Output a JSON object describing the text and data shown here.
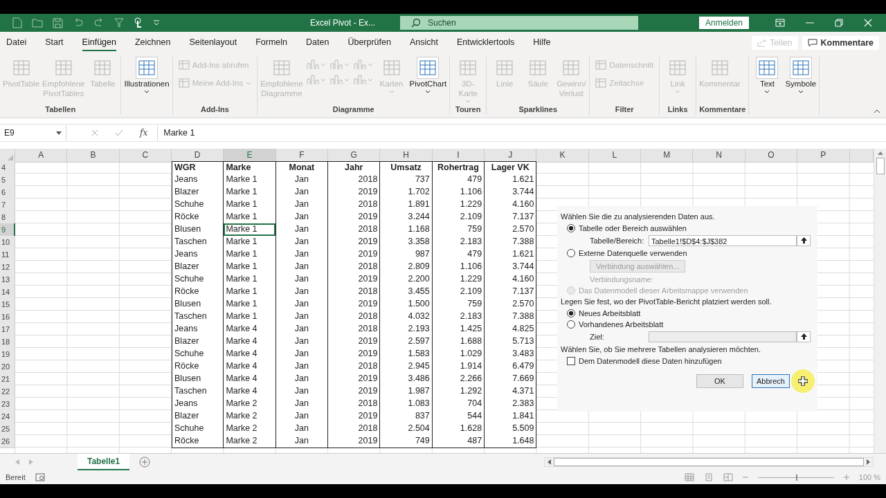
{
  "title_bar": {
    "title": "Excel Pivot  -  Ex...",
    "search_placeholder": "Suchen",
    "sign_in": "Anmelden"
  },
  "menu_tabs": [
    {
      "label": "Datei",
      "selected": false
    },
    {
      "label": "Start",
      "selected": false
    },
    {
      "label": "Einfügen",
      "selected": true
    },
    {
      "label": "Zeichnen",
      "selected": false
    },
    {
      "label": "Seitenlayout",
      "selected": false
    },
    {
      "label": "Formeln",
      "selected": false
    },
    {
      "label": "Daten",
      "selected": false
    },
    {
      "label": "Überprüfen",
      "selected": false
    },
    {
      "label": "Ansicht",
      "selected": false
    },
    {
      "label": "Entwicklertools",
      "selected": false
    },
    {
      "label": "Hilfe",
      "selected": false
    }
  ],
  "share_button": {
    "label": "Teilen",
    "disabled": true
  },
  "comments_button": {
    "label": "Kommentare"
  },
  "ribbon": [
    {
      "label": "Tabellen",
      "items": [
        {
          "kind": "large",
          "label": "PivotTable",
          "disabled": true
        },
        {
          "kind": "large",
          "label": "Empfohlene PivotTables",
          "disabled": true
        },
        {
          "kind": "large",
          "label": "Tabelle",
          "disabled": true
        }
      ]
    },
    {
      "items": [
        {
          "kind": "large",
          "label": "Illustrationen",
          "disabled": false,
          "dropdown": true
        }
      ]
    },
    {
      "label": "Add-Ins",
      "items": [
        {
          "kind": "small",
          "label": "Add-Ins abrufen",
          "disabled": true
        },
        {
          "kind": "small",
          "label": "Meine Add-Ins",
          "disabled": true,
          "dropdown": true
        }
      ]
    },
    {
      "label": "Diagramme",
      "items": [
        {
          "kind": "large",
          "label": "Empfohlene Diagramme",
          "disabled": true
        },
        {
          "kind": "gallery",
          "disabled": true
        },
        {
          "kind": "large",
          "label": "Karten",
          "disabled": true,
          "dropdown": true
        },
        {
          "kind": "large",
          "label": "PivotChart",
          "disabled": false,
          "dropdown": true
        }
      ]
    },
    {
      "label": "Touren",
      "items": [
        {
          "kind": "large",
          "label": "3D-Karte",
          "disabled": true,
          "dropdown": true
        }
      ]
    },
    {
      "label": "Sparklines",
      "items": [
        {
          "kind": "large",
          "label": "Linie",
          "disabled": true
        },
        {
          "kind": "large",
          "label": "Säule",
          "disabled": true
        },
        {
          "kind": "large",
          "label": "Gewinn/ Verlust",
          "disabled": true
        }
      ]
    },
    {
      "label": "Filter",
      "items": [
        {
          "kind": "small",
          "label": "Datenschnitt",
          "disabled": true
        },
        {
          "kind": "small",
          "label": "Zeitachse",
          "disabled": true
        }
      ]
    },
    {
      "label": "Links",
      "items": [
        {
          "kind": "large",
          "label": "Link",
          "disabled": true,
          "dropdown": true
        }
      ]
    },
    {
      "label": "Kommentare",
      "items": [
        {
          "kind": "large",
          "label": "Kommentar",
          "disabled": true
        }
      ]
    },
    {
      "items": [
        {
          "kind": "large",
          "label": "Text",
          "disabled": false,
          "dropdown": true
        },
        {
          "kind": "large",
          "label": "Symbole",
          "disabled": false,
          "dropdown": true
        }
      ]
    }
  ],
  "formula_bar": {
    "name_box": "E9",
    "function_label": "fx",
    "formula": "Marke 1"
  },
  "sheet": {
    "columns": [
      {
        "label": "A",
        "selected": false
      },
      {
        "label": "B",
        "selected": false
      },
      {
        "label": "C",
        "selected": false
      },
      {
        "label": "D",
        "selected": false
      },
      {
        "label": "E",
        "selected": true
      },
      {
        "label": "F",
        "selected": false
      },
      {
        "label": "G",
        "selected": false
      },
      {
        "label": "H",
        "selected": false
      },
      {
        "label": "I",
        "selected": false
      },
      {
        "label": "J",
        "selected": false
      },
      {
        "label": "K",
        "selected": false
      },
      {
        "label": "L",
        "selected": false
      },
      {
        "label": "M",
        "selected": false
      },
      {
        "label": "N",
        "selected": false
      },
      {
        "label": "O",
        "selected": false
      },
      {
        "label": "P",
        "selected": false
      }
    ],
    "rows": [
      {
        "number": "4",
        "kind": "header",
        "selected": false,
        "cells": [
          "",
          "",
          "",
          "WGR",
          "Marke",
          "Monat",
          "Jahr",
          "Umsatz",
          "Rohertrag",
          "Lager VK"
        ]
      },
      {
        "number": "5",
        "kind": "data",
        "selected": false,
        "cells": [
          "",
          "",
          "",
          "Jeans",
          "Marke 1",
          "Jan",
          "2018",
          "737",
          "479",
          "1.621"
        ]
      },
      {
        "number": "6",
        "kind": "data",
        "selected": false,
        "cells": [
          "",
          "",
          "",
          "Blazer",
          "Marke 1",
          "Jan",
          "2019",
          "1.702",
          "1.106",
          "3.744"
        ]
      },
      {
        "number": "7",
        "kind": "data",
        "selected": false,
        "cells": [
          "",
          "",
          "",
          "Schuhe",
          "Marke 1",
          "Jan",
          "2018",
          "1.891",
          "1.229",
          "4.160"
        ]
      },
      {
        "number": "8",
        "kind": "data",
        "selected": false,
        "cells": [
          "",
          "",
          "",
          "Röcke",
          "Marke 1",
          "Jan",
          "2019",
          "3.244",
          "2.109",
          "7.137"
        ]
      },
      {
        "number": "9",
        "kind": "data",
        "selected": true,
        "cells": [
          "",
          "",
          "",
          "Blusen",
          "Marke 1",
          "Jan",
          "2018",
          "1.168",
          "759",
          "2.570"
        ]
      },
      {
        "number": "10",
        "kind": "data",
        "selected": false,
        "cells": [
          "",
          "",
          "",
          "Taschen",
          "Marke 1",
          "Jan",
          "2019",
          "3.358",
          "2.183",
          "7.388"
        ]
      },
      {
        "number": "11",
        "kind": "data",
        "selected": false,
        "cells": [
          "",
          "",
          "",
          "Jeans",
          "Marke 1",
          "Jan",
          "2019",
          "987",
          "479",
          "1.621"
        ]
      },
      {
        "number": "12",
        "kind": "data",
        "selected": false,
        "cells": [
          "",
          "",
          "",
          "Blazer",
          "Marke 1",
          "Jan",
          "2018",
          "2.809",
          "1.106",
          "3.744"
        ]
      },
      {
        "number": "13",
        "kind": "data",
        "selected": false,
        "cells": [
          "",
          "",
          "",
          "Schuhe",
          "Marke 1",
          "Jan",
          "2019",
          "2.200",
          "1.229",
          "4.160"
        ]
      },
      {
        "number": "14",
        "kind": "data",
        "selected": false,
        "cells": [
          "",
          "",
          "",
          "Röcke",
          "Marke 1",
          "Jan",
          "2018",
          "3.455",
          "2.109",
          "7.137"
        ]
      },
      {
        "number": "15",
        "kind": "data",
        "selected": false,
        "cells": [
          "",
          "",
          "",
          "Blusen",
          "Marke 1",
          "Jan",
          "2019",
          "1.500",
          "759",
          "2.570"
        ]
      },
      {
        "number": "16",
        "kind": "data",
        "selected": false,
        "cells": [
          "",
          "",
          "",
          "Taschen",
          "Marke 1",
          "Jan",
          "2018",
          "4.032",
          "2.183",
          "7.388"
        ]
      },
      {
        "number": "17",
        "kind": "data",
        "selected": false,
        "cells": [
          "",
          "",
          "",
          "Jeans",
          "Marke 4",
          "Jan",
          "2018",
          "2.193",
          "1.425",
          "4.825"
        ]
      },
      {
        "number": "18",
        "kind": "data",
        "selected": false,
        "cells": [
          "",
          "",
          "",
          "Blazer",
          "Marke 4",
          "Jan",
          "2019",
          "2.597",
          "1.688",
          "5.713"
        ]
      },
      {
        "number": "19",
        "kind": "data",
        "selected": false,
        "cells": [
          "",
          "",
          "",
          "Schuhe",
          "Marke 4",
          "Jan",
          "2019",
          "1.583",
          "1.029",
          "3.483"
        ]
      },
      {
        "number": "20",
        "kind": "data",
        "selected": false,
        "cells": [
          "",
          "",
          "",
          "Röcke",
          "Marke 4",
          "Jan",
          "2018",
          "2.945",
          "1.914",
          "6.479"
        ]
      },
      {
        "number": "21",
        "kind": "data",
        "selected": false,
        "cells": [
          "",
          "",
          "",
          "Blusen",
          "Marke 4",
          "Jan",
          "2019",
          "3.486",
          "2.266",
          "7.669"
        ]
      },
      {
        "number": "22",
        "kind": "data",
        "selected": false,
        "cells": [
          "",
          "",
          "",
          "Taschen",
          "Marke 4",
          "Jan",
          "2019",
          "1.987",
          "1.292",
          "4.371"
        ]
      },
      {
        "number": "23",
        "kind": "data",
        "selected": false,
        "cells": [
          "",
          "",
          "",
          "Jeans",
          "Marke 2",
          "Jan",
          "2018",
          "1.083",
          "704",
          "2.383"
        ]
      },
      {
        "number": "24",
        "kind": "data",
        "selected": false,
        "cells": [
          "",
          "",
          "",
          "Blazer",
          "Marke 2",
          "Jan",
          "2019",
          "837",
          "544",
          "1.841"
        ]
      },
      {
        "number": "25",
        "kind": "data",
        "selected": false,
        "cells": [
          "",
          "",
          "",
          "Schuhe",
          "Marke 2",
          "Jan",
          "2018",
          "2.504",
          "1.628",
          "5.509"
        ]
      },
      {
        "number": "26",
        "kind": "data",
        "selected": false,
        "cells": [
          "",
          "",
          "",
          "Röcke",
          "Marke 2",
          "Jan",
          "2019",
          "749",
          "487",
          "1.648"
        ]
      }
    ]
  },
  "dialog": {
    "items": [
      {
        "kind": "heading",
        "text": "Wählen Sie die zu analysierenden Daten aus."
      },
      {
        "kind": "radio",
        "text": "Tabelle oder Bereich auswählen",
        "selected": true,
        "disabled": false
      },
      {
        "kind": "field",
        "text": "Tabelle/Bereich:",
        "value": "Tabelle1!$D$4:$J$382",
        "disabled": false
      },
      {
        "kind": "radio",
        "text": "Externe Datenquelle verwenden",
        "selected": false,
        "disabled": false
      },
      {
        "kind": "button",
        "text": "Verbindung auswählen...",
        "disabled": true
      },
      {
        "kind": "caption",
        "text": "Verbindungsname:",
        "disabled": true
      },
      {
        "kind": "radio",
        "text": "Das Datenmodell dieser Arbeitsmappe verwenden",
        "selected": false,
        "disabled": true
      },
      {
        "kind": "heading",
        "text": "Legen Sie fest, wo der PivotTable-Bericht platziert werden soll."
      },
      {
        "kind": "radio",
        "text": "Neues Arbeitsblatt",
        "selected": true,
        "disabled": false
      },
      {
        "kind": "radio",
        "text": "Vorhandenes Arbeitsblatt",
        "selected": false,
        "disabled": false
      },
      {
        "kind": "field",
        "text": "Ziel:",
        "disabled": true
      },
      {
        "kind": "heading",
        "text": "Wählen Sie, ob Sie mehrere Tabellen analysieren möchten."
      },
      {
        "kind": "checkbox",
        "text": "Dem Datenmodell diese Daten hinzufügen",
        "checked": false
      }
    ],
    "buttons": [
      {
        "label": "OK",
        "focused": false
      },
      {
        "label": "Abbrech",
        "focused": true
      }
    ]
  },
  "sheet_tabs": [
    {
      "label": "Tabelle1",
      "selected": true
    }
  ],
  "status_bar": {
    "status": "Bereit",
    "level": 0.5,
    "zoom": "100 %"
  }
}
